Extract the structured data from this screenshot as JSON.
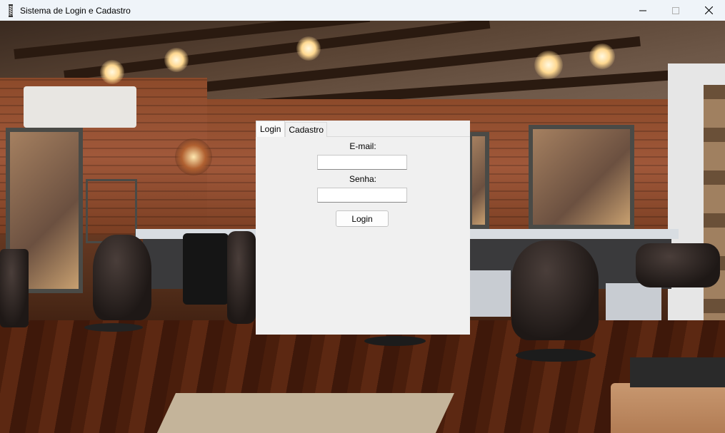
{
  "window": {
    "title": "Sistema de Login e Cadastro",
    "app_icon": "barber-pole-icon",
    "controls": [
      "minimize-icon",
      "maximize-icon",
      "close-icon"
    ]
  },
  "background": {
    "description_icon": "barbershop-photo"
  },
  "tabs": [
    {
      "label": "Login",
      "active": true
    },
    {
      "label": "Cadastro",
      "active": false
    }
  ],
  "login_form": {
    "email_label": "E-mail:",
    "email_value": "",
    "password_label": "Senha:",
    "password_value": "",
    "submit_label": "Login"
  },
  "colors": {
    "panel_bg": "#f0f0f0",
    "titlebar_bg": "#eff4f9"
  }
}
